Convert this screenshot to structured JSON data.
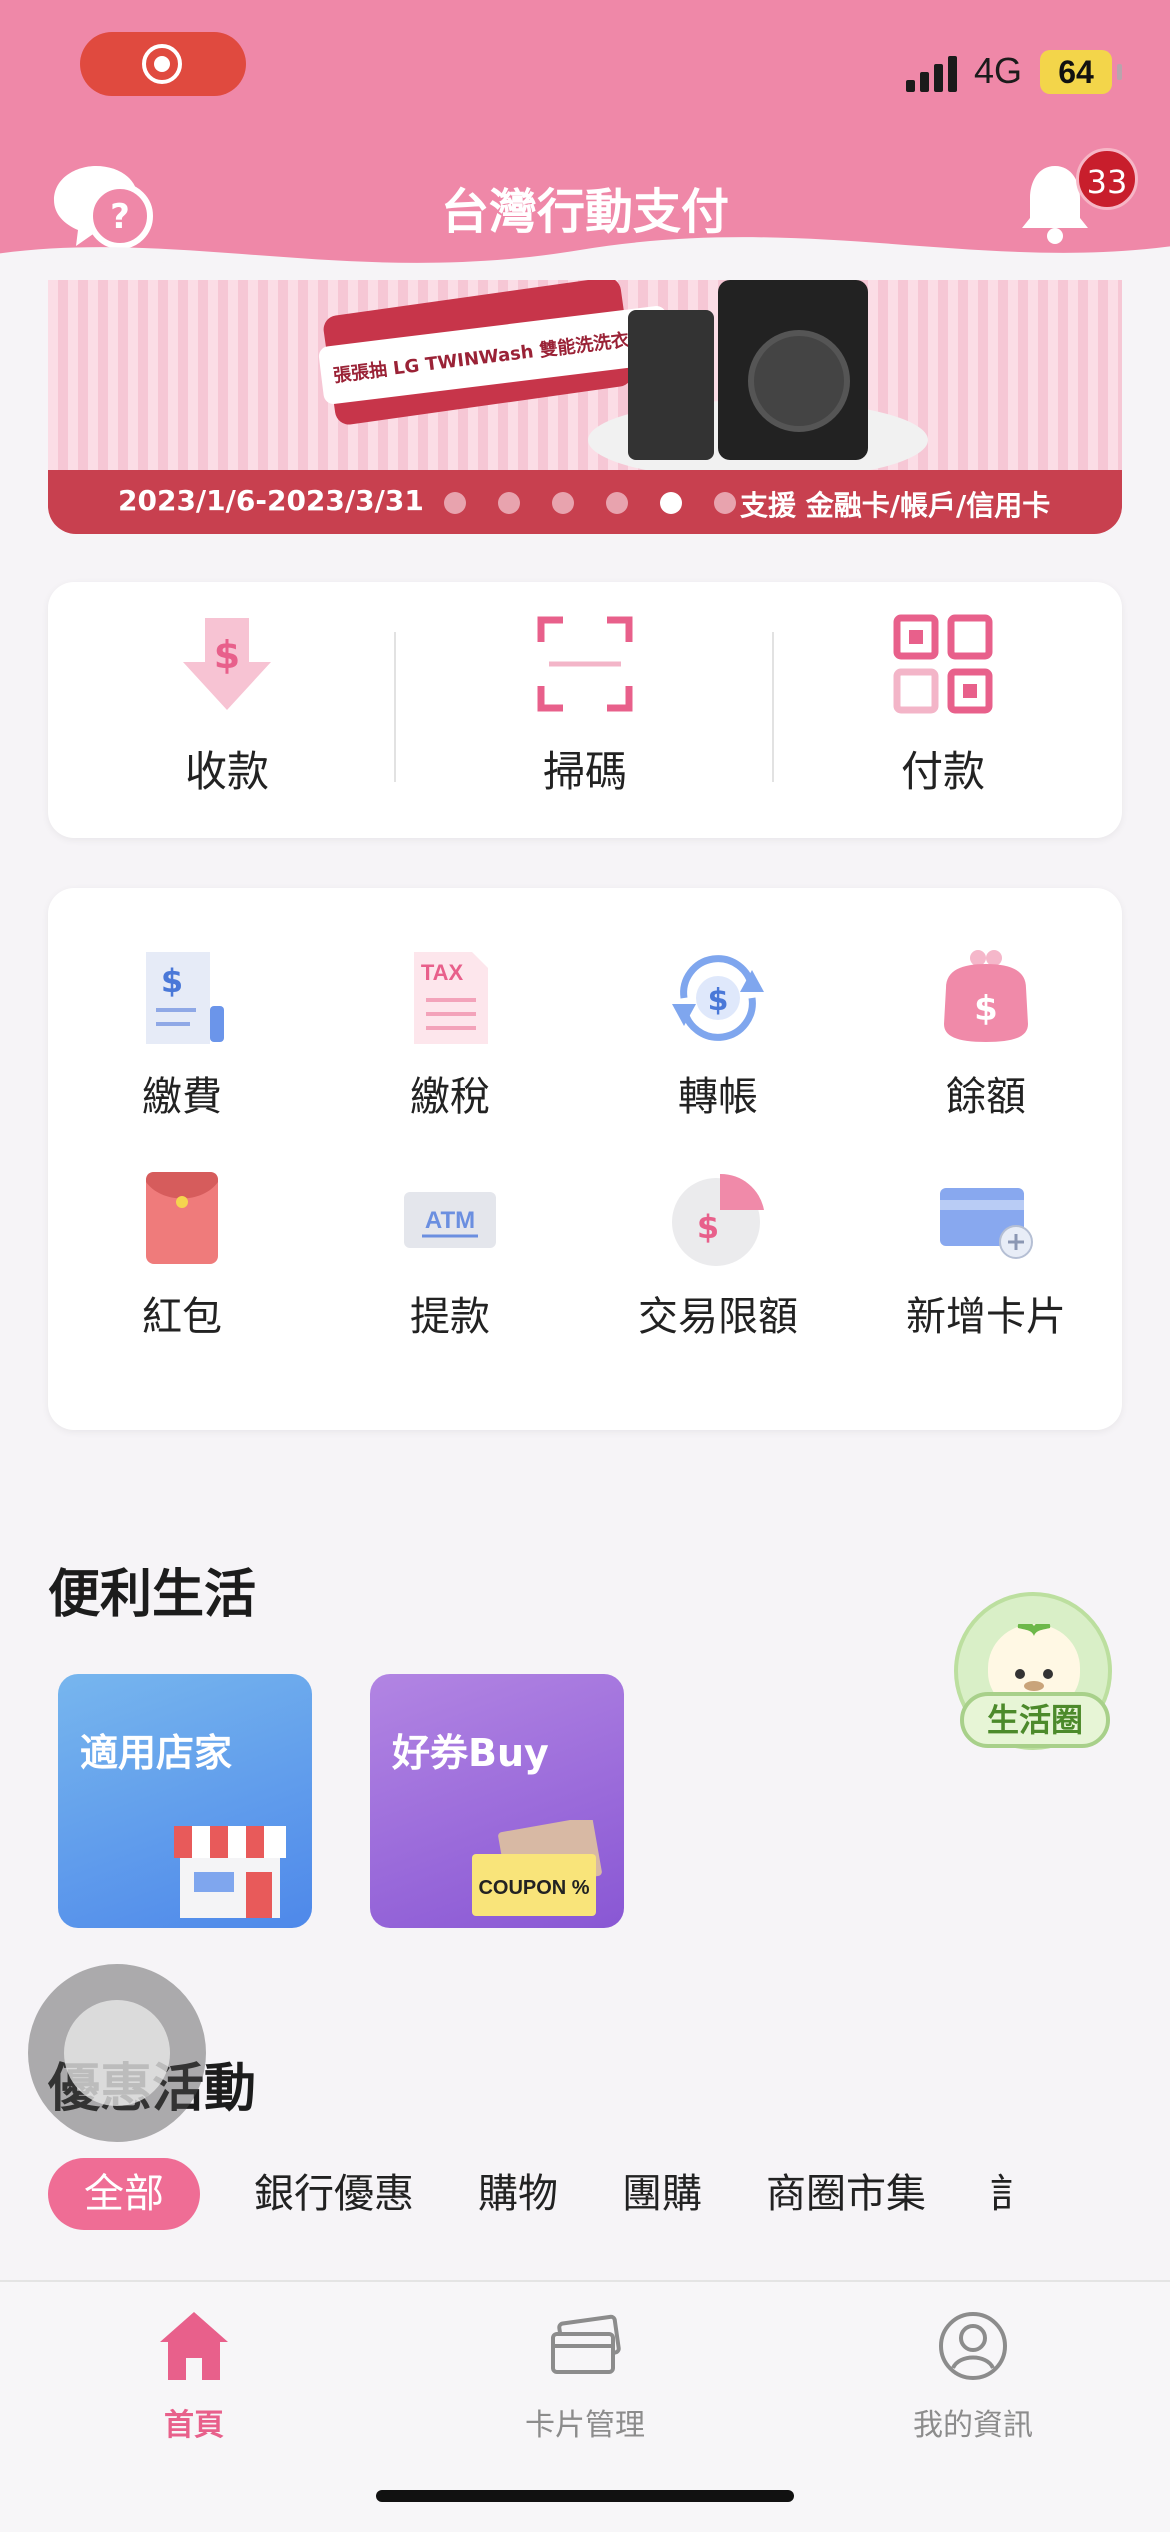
{
  "status_bar": {
    "network": "4G",
    "battery": "64"
  },
  "header": {
    "title": "台灣行動支付",
    "notification_count": "33"
  },
  "banner": {
    "promo_text": "張張抽 LG TWINWash 雙能洗洗衣機",
    "date_range": "2023/1/6-2023/3/31",
    "support_text": "支援 金融卡/帳戶/信用卡",
    "slide_count": 6,
    "active_slide": 5
  },
  "quick_actions": [
    {
      "label": "收款",
      "icon": "receive-money-icon"
    },
    {
      "label": "掃碼",
      "icon": "scan-icon"
    },
    {
      "label": "付款",
      "icon": "qr-code-icon"
    }
  ],
  "services": [
    {
      "label": "繳費",
      "icon": "bill-icon"
    },
    {
      "label": "繳稅",
      "icon": "tax-icon"
    },
    {
      "label": "轉帳",
      "icon": "transfer-icon"
    },
    {
      "label": "餘額",
      "icon": "purse-icon"
    },
    {
      "label": "紅包",
      "icon": "red-envelope-icon"
    },
    {
      "label": "提款",
      "icon": "atm-icon"
    },
    {
      "label": "交易限額",
      "icon": "pie-limit-icon"
    },
    {
      "label": "新增卡片",
      "icon": "add-card-icon"
    }
  ],
  "convenience": {
    "title": "便利生活",
    "tiles": [
      {
        "label": "適用店家",
        "icon": "store-icon"
      },
      {
        "label": "好券Buy",
        "icon": "coupon-icon",
        "badge": "COUPON %"
      }
    ],
    "life_circle_label": "生活圈"
  },
  "promotions": {
    "title": "優惠活動",
    "chips": [
      "全部",
      "銀行優惠",
      "購物",
      "團購",
      "商圈市集",
      "訁"
    ],
    "active_chip": 0
  },
  "bottom_nav": [
    {
      "label": "首頁",
      "icon": "home-icon",
      "active": true
    },
    {
      "label": "卡片管理",
      "icon": "cards-icon",
      "active": false
    },
    {
      "label": "我的資訊",
      "icon": "profile-icon",
      "active": false
    }
  ],
  "colors": {
    "brand_pink": "#ef88a8",
    "accent": "#e8608b",
    "banner_bar": "#c8404f"
  }
}
